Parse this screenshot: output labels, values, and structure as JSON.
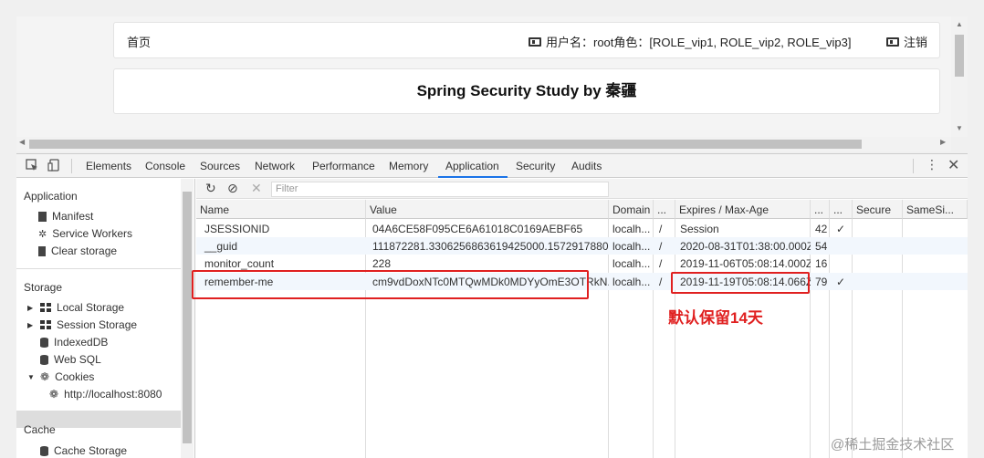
{
  "page": {
    "home_label": "首页",
    "user_info": "用户名：root角色：[ROLE_vip1, ROLE_vip2, ROLE_vip3]",
    "logout_label": "注销",
    "heading": "Spring Security Study by 秦疆"
  },
  "devtools": {
    "tabs": [
      "Elements",
      "Console",
      "Sources",
      "Network",
      "Performance",
      "Memory",
      "Application",
      "Security",
      "Audits"
    ],
    "active_tab": "Application",
    "sidebar": {
      "application_header": "Application",
      "application_items": [
        "Manifest",
        "Service Workers",
        "Clear storage"
      ],
      "storage_header": "Storage",
      "storage_items": [
        "Local Storage",
        "Session Storage",
        "IndexedDB",
        "Web SQL",
        "Cookies",
        "http://localhost:8080"
      ],
      "cache_header": "Cache",
      "cache_items": [
        "Cache Storage"
      ]
    },
    "filter_placeholder": "Filter",
    "columns": [
      "Name",
      "Value",
      "Domain",
      "...",
      "Expires / Max-Age",
      "...",
      "...",
      "Secure",
      "SameSi..."
    ],
    "cookies": [
      {
        "name": "JSESSIONID",
        "value": "04A6CE58F095CE6A61018C0169AEBF65",
        "domain": "localh...",
        "path": "/",
        "expires": "Session",
        "size": "42",
        "httponly": "✓"
      },
      {
        "name": "__guid",
        "value": "111872281.3306256863619425000.1572917880...",
        "domain": "localh...",
        "path": "/",
        "expires": "2020-08-31T01:38:00.000Z",
        "size": "54",
        "httponly": ""
      },
      {
        "name": "monitor_count",
        "value": "228",
        "domain": "localh...",
        "path": "/",
        "expires": "2019-11-06T05:08:14.000Z",
        "size": "16",
        "httponly": ""
      },
      {
        "name": "remember-me",
        "value": "cm9vdDoxNTc0MTQwMDk0MDYyOmE3OTRkN...",
        "domain": "localh...",
        "path": "/",
        "expires": "2019-11-19T05:08:14.066Z",
        "size": "79",
        "httponly": "✓"
      }
    ]
  },
  "annotation": "默认保留14天",
  "watermark": "@稀土掘金技术社区",
  "colors": {
    "highlight_red": "#e02020",
    "accent_blue": "#1a73e8"
  }
}
